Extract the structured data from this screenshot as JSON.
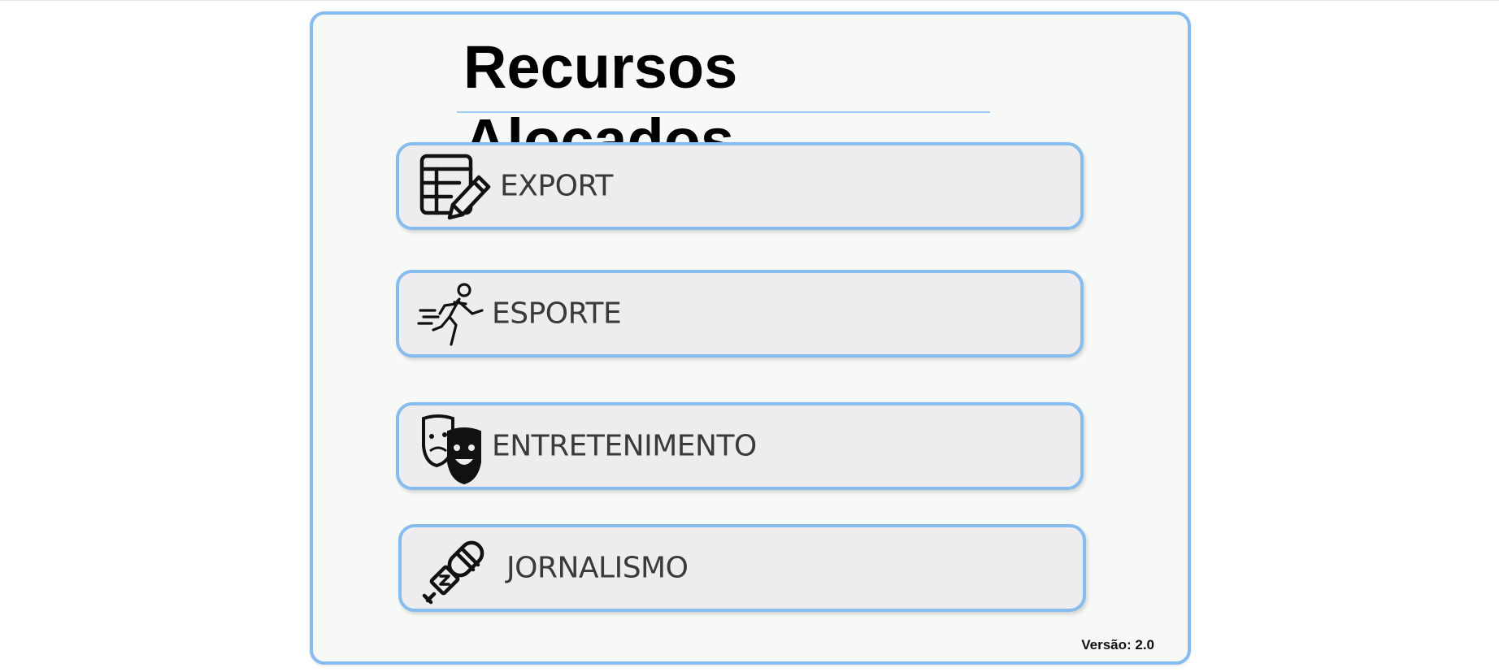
{
  "page": {
    "title": "Recursos Alocados",
    "version_text": "Versão: 2.0"
  },
  "menu": {
    "items": [
      {
        "label": "EXPORT",
        "icon": "table-edit-icon"
      },
      {
        "label": "ESPORTE",
        "icon": "runner-icon"
      },
      {
        "label": "ENTRETENIMENTO",
        "icon": "theater-masks-icon"
      },
      {
        "label": "JORNALISMO",
        "icon": "microphone-icon"
      }
    ]
  },
  "colors": {
    "accent_border": "#86bcee",
    "panel_background": "#f6f9f5",
    "button_background": "#efecef",
    "text": "#3a3a3a"
  }
}
